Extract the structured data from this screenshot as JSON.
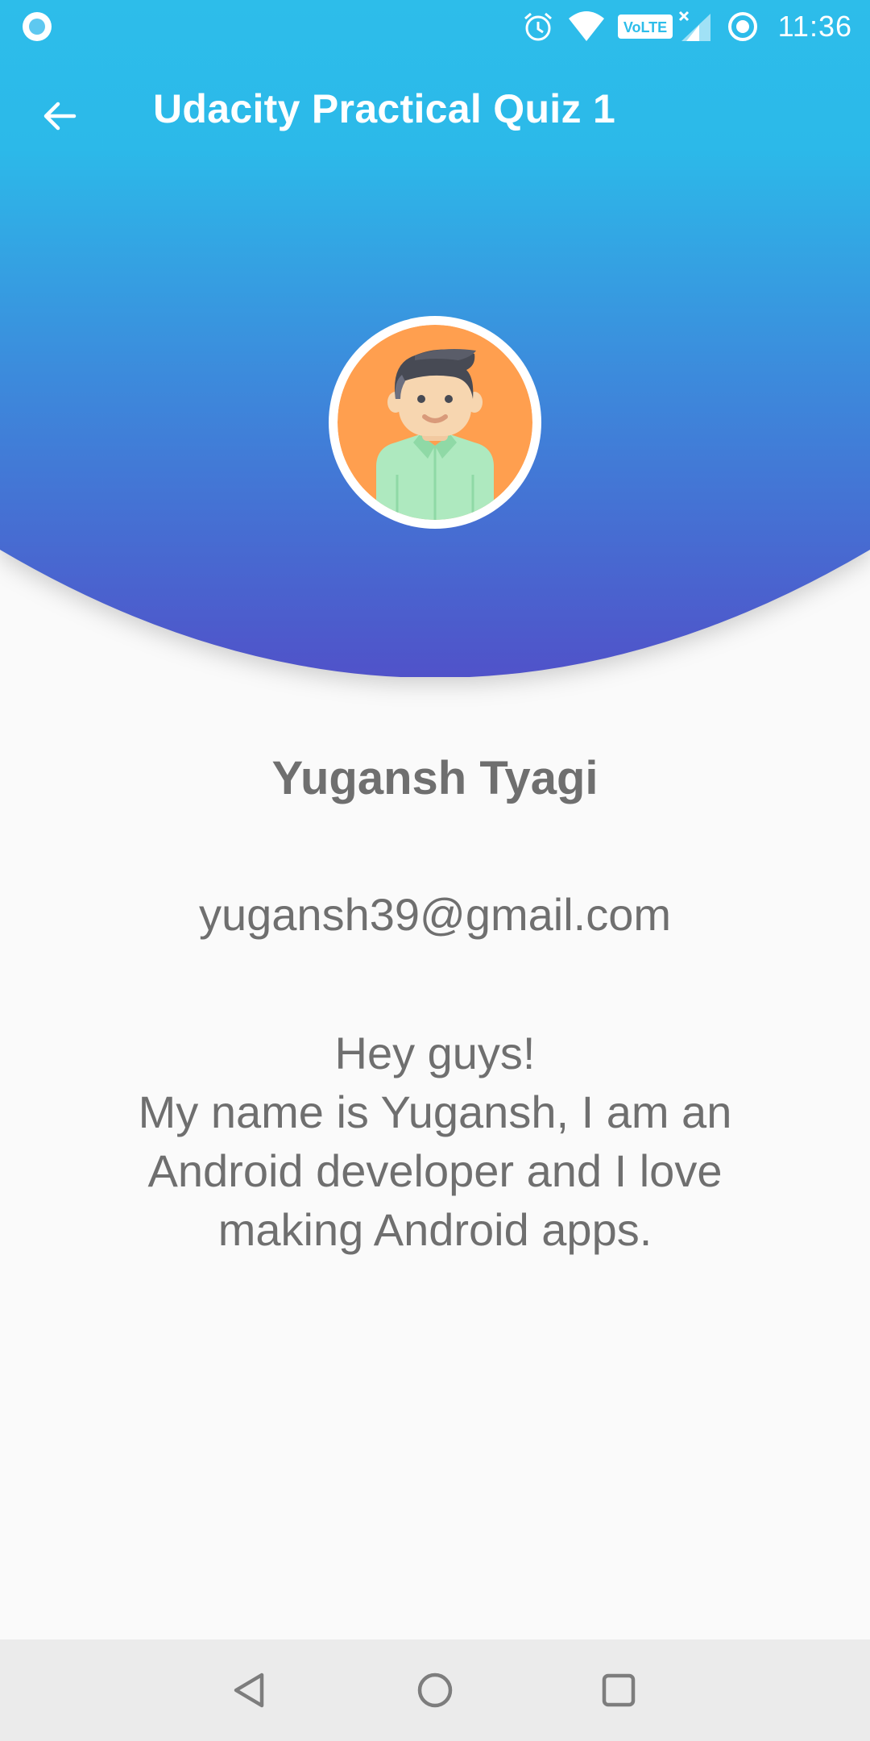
{
  "status_bar": {
    "time": "11:36",
    "icons": [
      "notification-dot-icon",
      "alarm-icon",
      "wifi-icon",
      "volte-icon",
      "signal-icon",
      "data-saver-icon"
    ],
    "volte_label": "VoLTE"
  },
  "toolbar": {
    "title": "Udacity Practical Quiz 1",
    "back_icon": "arrow-left-icon"
  },
  "header": {
    "gradient_top": "#2dbdea",
    "gradient_bottom": "#5052c9"
  },
  "profile": {
    "avatar_icon": "user-avatar-icon",
    "name": "Yugansh Tyagi",
    "email": "yugansh39@gmail.com",
    "bio_lines": [
      "Hey guys!",
      "My name is Yugansh, I am an",
      "Android developer and I love",
      "making Android apps."
    ]
  },
  "nav_bar": {
    "buttons": [
      "back-triangle-icon",
      "home-circle-icon",
      "recents-square-icon"
    ]
  },
  "colors": {
    "text_gray": "#6f6f6f",
    "background": "#fafafa",
    "nav_background": "#ebebeb",
    "avatar_orange": "#ff9f4f",
    "shirt_green": "#aee9bf"
  }
}
